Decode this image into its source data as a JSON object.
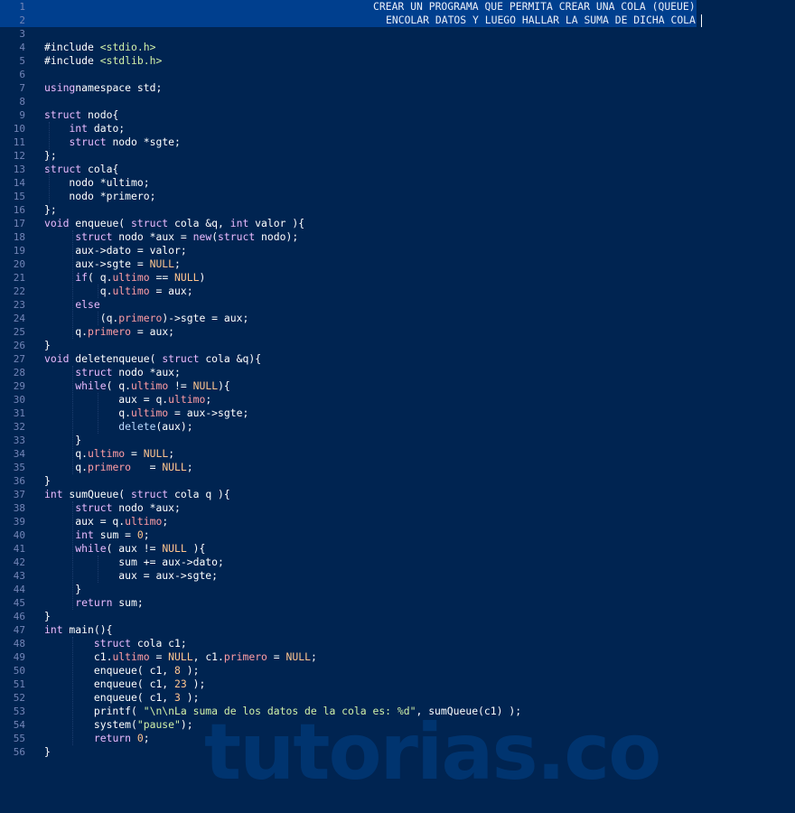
{
  "editor": {
    "theme_colors": {
      "background": "#002451",
      "line_highlight": "#003f8e",
      "gutter_text": "#7285b7",
      "keyword": "#ebbbff",
      "type": "#bbdaff",
      "string": "#d1f1a9",
      "number": "#ffc58f",
      "member": "#ff9da4"
    },
    "header_comment": {
      "line1": "CREAR·UN·PROGRAMA·QUE·PERMITA·CREAR·UNA·COLA·(QUEUE)",
      "line2": "ENCOLAR·DATOS·Y·LUEGO·HALLAR·LA·SUMA·DE·DICHA·COLA"
    },
    "lines": [
      {
        "n": "1"
      },
      {
        "n": "2"
      },
      {
        "n": "3"
      },
      {
        "n": "4"
      },
      {
        "n": "5"
      },
      {
        "n": "6"
      },
      {
        "n": "7"
      },
      {
        "n": "8"
      },
      {
        "n": "9"
      },
      {
        "n": "10"
      },
      {
        "n": "11"
      },
      {
        "n": "12"
      },
      {
        "n": "13"
      },
      {
        "n": "14"
      },
      {
        "n": "15"
      },
      {
        "n": "16"
      },
      {
        "n": "17"
      },
      {
        "n": "18"
      },
      {
        "n": "19"
      },
      {
        "n": "20"
      },
      {
        "n": "21"
      },
      {
        "n": "22"
      },
      {
        "n": "23"
      },
      {
        "n": "24"
      },
      {
        "n": "25"
      },
      {
        "n": "26"
      },
      {
        "n": "27"
      },
      {
        "n": "28"
      },
      {
        "n": "29"
      },
      {
        "n": "30"
      },
      {
        "n": "31"
      },
      {
        "n": "32"
      },
      {
        "n": "33"
      },
      {
        "n": "34"
      },
      {
        "n": "35"
      },
      {
        "n": "36"
      },
      {
        "n": "37"
      },
      {
        "n": "38"
      },
      {
        "n": "39"
      },
      {
        "n": "40"
      },
      {
        "n": "41"
      },
      {
        "n": "42"
      },
      {
        "n": "43"
      },
      {
        "n": "44"
      },
      {
        "n": "45"
      },
      {
        "n": "46"
      },
      {
        "n": "47"
      },
      {
        "n": "48"
      },
      {
        "n": "49"
      },
      {
        "n": "50"
      },
      {
        "n": "51"
      },
      {
        "n": "52"
      },
      {
        "n": "53"
      },
      {
        "n": "54"
      },
      {
        "n": "55"
      },
      {
        "n": "56"
      }
    ],
    "code": {
      "4": [
        [
          "pp",
          "#include "
        ],
        [
          "str",
          "<stdio.h>"
        ]
      ],
      "5": [
        [
          "pp",
          "#include "
        ],
        [
          "str",
          "<stdlib.h>"
        ]
      ],
      "7": [
        [
          "kw",
          "using"
        ],
        [
          "",
          "namespace std;"
        ]
      ],
      "9": [
        [
          "kw",
          "struct"
        ],
        [
          "",
          " nodo{"
        ]
      ],
      "10": [
        [
          "",
          "    "
        ],
        [
          "kw",
          "int"
        ],
        [
          "",
          " dato;"
        ]
      ],
      "11": [
        [
          "",
          "    "
        ],
        [
          "kw",
          "struct"
        ],
        [
          "",
          " nodo *sgte;"
        ]
      ],
      "12": [
        [
          "",
          "};"
        ]
      ],
      "13": [
        [
          "kw",
          "struct"
        ],
        [
          "",
          " cola{"
        ]
      ],
      "14": [
        [
          "",
          "    nodo *ultimo;"
        ]
      ],
      "15": [
        [
          "",
          "    nodo *primero;"
        ]
      ],
      "16": [
        [
          "",
          "};"
        ]
      ],
      "17": [
        [
          "kw",
          "void"
        ],
        [
          "",
          " enqueue( "
        ],
        [
          "kw",
          "struct"
        ],
        [
          "",
          " cola &q, "
        ],
        [
          "kw",
          "int"
        ],
        [
          "",
          " valor ){"
        ]
      ],
      "18": [
        [
          "",
          "     "
        ],
        [
          "kw",
          "struct"
        ],
        [
          "",
          " nodo *aux = "
        ],
        [
          "kw",
          "new"
        ],
        [
          "",
          "("
        ],
        [
          "kw",
          "struct"
        ],
        [
          "",
          " nodo);"
        ]
      ],
      "19": [
        [
          "",
          "     aux->dato = valor;"
        ]
      ],
      "20": [
        [
          "",
          "     aux->sgte = "
        ],
        [
          "nul",
          "NULL"
        ],
        [
          "",
          ";"
        ]
      ],
      "21": [
        [
          "",
          "     "
        ],
        [
          "kw",
          "if"
        ],
        [
          "",
          "( q."
        ],
        [
          "mem",
          "ultimo"
        ],
        [
          "",
          " == "
        ],
        [
          "nul",
          "NULL"
        ],
        [
          "",
          ")"
        ]
      ],
      "22": [
        [
          "",
          "         q."
        ],
        [
          "mem",
          "ultimo"
        ],
        [
          "",
          " = aux;"
        ]
      ],
      "23": [
        [
          "",
          "     "
        ],
        [
          "kw",
          "else"
        ]
      ],
      "24": [
        [
          "",
          "         (q."
        ],
        [
          "mem",
          "primero"
        ],
        [
          "",
          ")->sgte = aux;"
        ]
      ],
      "25": [
        [
          "",
          "     q."
        ],
        [
          "mem",
          "primero"
        ],
        [
          "",
          " = aux;"
        ]
      ],
      "26": [
        [
          "",
          "}"
        ]
      ],
      "27": [
        [
          "kw",
          "void"
        ],
        [
          "",
          " deletenqueue( "
        ],
        [
          "kw",
          "struct"
        ],
        [
          "",
          " cola &q){"
        ]
      ],
      "28": [
        [
          "",
          "     "
        ],
        [
          "kw",
          "struct"
        ],
        [
          "",
          " nodo *aux;"
        ]
      ],
      "29": [
        [
          "",
          "     "
        ],
        [
          "kw",
          "while"
        ],
        [
          "",
          "( q."
        ],
        [
          "mem",
          "ultimo"
        ],
        [
          "",
          " != "
        ],
        [
          "nul",
          "NULL"
        ],
        [
          "",
          "){"
        ]
      ],
      "30": [
        [
          "",
          "            aux = q."
        ],
        [
          "mem",
          "ultimo"
        ],
        [
          "",
          ";"
        ]
      ],
      "31": [
        [
          "",
          "            q."
        ],
        [
          "mem",
          "ultimo"
        ],
        [
          "",
          " = aux->sgte;"
        ]
      ],
      "32": [
        [
          "",
          "            "
        ],
        [
          "ty",
          "delete"
        ],
        [
          "",
          "(aux);"
        ]
      ],
      "33": [
        [
          "",
          "     }"
        ]
      ],
      "34": [
        [
          "",
          "     q."
        ],
        [
          "mem",
          "ultimo"
        ],
        [
          "",
          " = "
        ],
        [
          "nul",
          "NULL"
        ],
        [
          "",
          ";"
        ]
      ],
      "35": [
        [
          "",
          "     q."
        ],
        [
          "mem",
          "primero"
        ],
        [
          "",
          "   = "
        ],
        [
          "nul",
          "NULL"
        ],
        [
          "",
          ";"
        ]
      ],
      "36": [
        [
          "",
          "}"
        ]
      ],
      "37": [
        [
          "kw",
          "int"
        ],
        [
          "",
          " sumQueue( "
        ],
        [
          "kw",
          "struct"
        ],
        [
          "",
          " cola q ){"
        ]
      ],
      "38": [
        [
          "",
          "     "
        ],
        [
          "kw",
          "struct"
        ],
        [
          "",
          " nodo *aux;"
        ]
      ],
      "39": [
        [
          "",
          "     aux = q."
        ],
        [
          "mem",
          "ultimo"
        ],
        [
          "",
          ";"
        ]
      ],
      "40": [
        [
          "",
          "     "
        ],
        [
          "kw",
          "int"
        ],
        [
          "",
          " sum = "
        ],
        [
          "num",
          "0"
        ],
        [
          "",
          ";"
        ]
      ],
      "41": [
        [
          "",
          "     "
        ],
        [
          "kw",
          "while"
        ],
        [
          "",
          "( aux != "
        ],
        [
          "nul",
          "NULL"
        ],
        [
          "",
          " ){"
        ]
      ],
      "42": [
        [
          "",
          "            sum += aux->dato;"
        ]
      ],
      "43": [
        [
          "",
          "            aux = aux->sgte;"
        ]
      ],
      "44": [
        [
          "",
          "     }"
        ]
      ],
      "45": [
        [
          "",
          "     "
        ],
        [
          "kw",
          "return"
        ],
        [
          "",
          " sum;"
        ]
      ],
      "46": [
        [
          "",
          "}"
        ]
      ],
      "47": [
        [
          "kw",
          "int"
        ],
        [
          "",
          " main(){"
        ]
      ],
      "48": [
        [
          "",
          "        "
        ],
        [
          "kw",
          "struct"
        ],
        [
          "",
          " cola c1;"
        ]
      ],
      "49": [
        [
          "",
          "        c1."
        ],
        [
          "mem",
          "ultimo"
        ],
        [
          "",
          " = "
        ],
        [
          "nul",
          "NULL"
        ],
        [
          "",
          ", c1."
        ],
        [
          "mem",
          "primero"
        ],
        [
          "",
          " = "
        ],
        [
          "nul",
          "NULL"
        ],
        [
          "",
          ";"
        ]
      ],
      "50": [
        [
          "",
          "        enqueue( c1, "
        ],
        [
          "num",
          "8"
        ],
        [
          "",
          " );"
        ]
      ],
      "51": [
        [
          "",
          "        enqueue( c1, "
        ],
        [
          "num",
          "23"
        ],
        [
          "",
          " );"
        ]
      ],
      "52": [
        [
          "",
          "        enqueue( c1, "
        ],
        [
          "num",
          "3"
        ],
        [
          "",
          " );"
        ]
      ],
      "53": [
        [
          "",
          "        printf( "
        ],
        [
          "str",
          "\"\\n\\nLa suma de los datos de la cola es: %d\""
        ],
        [
          "",
          ", sumQueue(c1) );"
        ]
      ],
      "54": [
        [
          "",
          "        system("
        ],
        [
          "str",
          "\"pause\""
        ],
        [
          "",
          ");"
        ]
      ],
      "55": [
        [
          "",
          "        "
        ],
        [
          "kw",
          "return"
        ],
        [
          "",
          " "
        ],
        [
          "num",
          "0"
        ],
        [
          "",
          ";"
        ]
      ],
      "56": [
        [
          "",
          "}"
        ]
      ]
    }
  },
  "watermark": "tutorias.co"
}
